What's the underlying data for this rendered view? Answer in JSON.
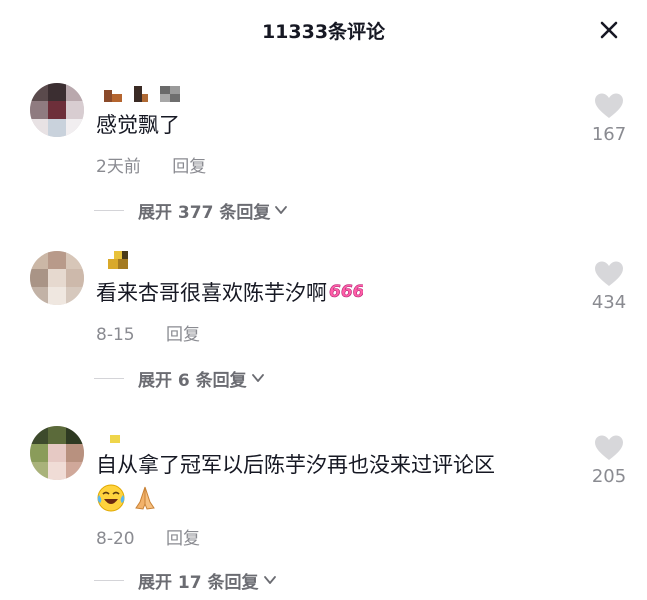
{
  "header": {
    "title": "11333条评论",
    "close_icon": "close-icon"
  },
  "comments": [
    {
      "text": "感觉飘了",
      "time": "2天前",
      "reply_label": "回复",
      "expand_label": "展开 377 条回复",
      "like_count": "167"
    },
    {
      "text": "看来杏哥很喜欢陈芋汐啊",
      "text_emoji": "666",
      "time": "8-15",
      "reply_label": "回复",
      "expand_label": "展开 6 条回复",
      "like_count": "434"
    },
    {
      "text": "自从拿了冠军以后陈芋汐再也没来过评论区",
      "emojis": [
        "crying-laughing-emoji",
        "praying-hands-emoji"
      ],
      "time": "8-20",
      "reply_label": "回复",
      "expand_label": "展开 17 条回复",
      "like_count": "205"
    }
  ],
  "colors": {
    "text_primary": "#161823",
    "text_secondary": "#8a8b91",
    "heart_gray": "#d7d7da"
  }
}
